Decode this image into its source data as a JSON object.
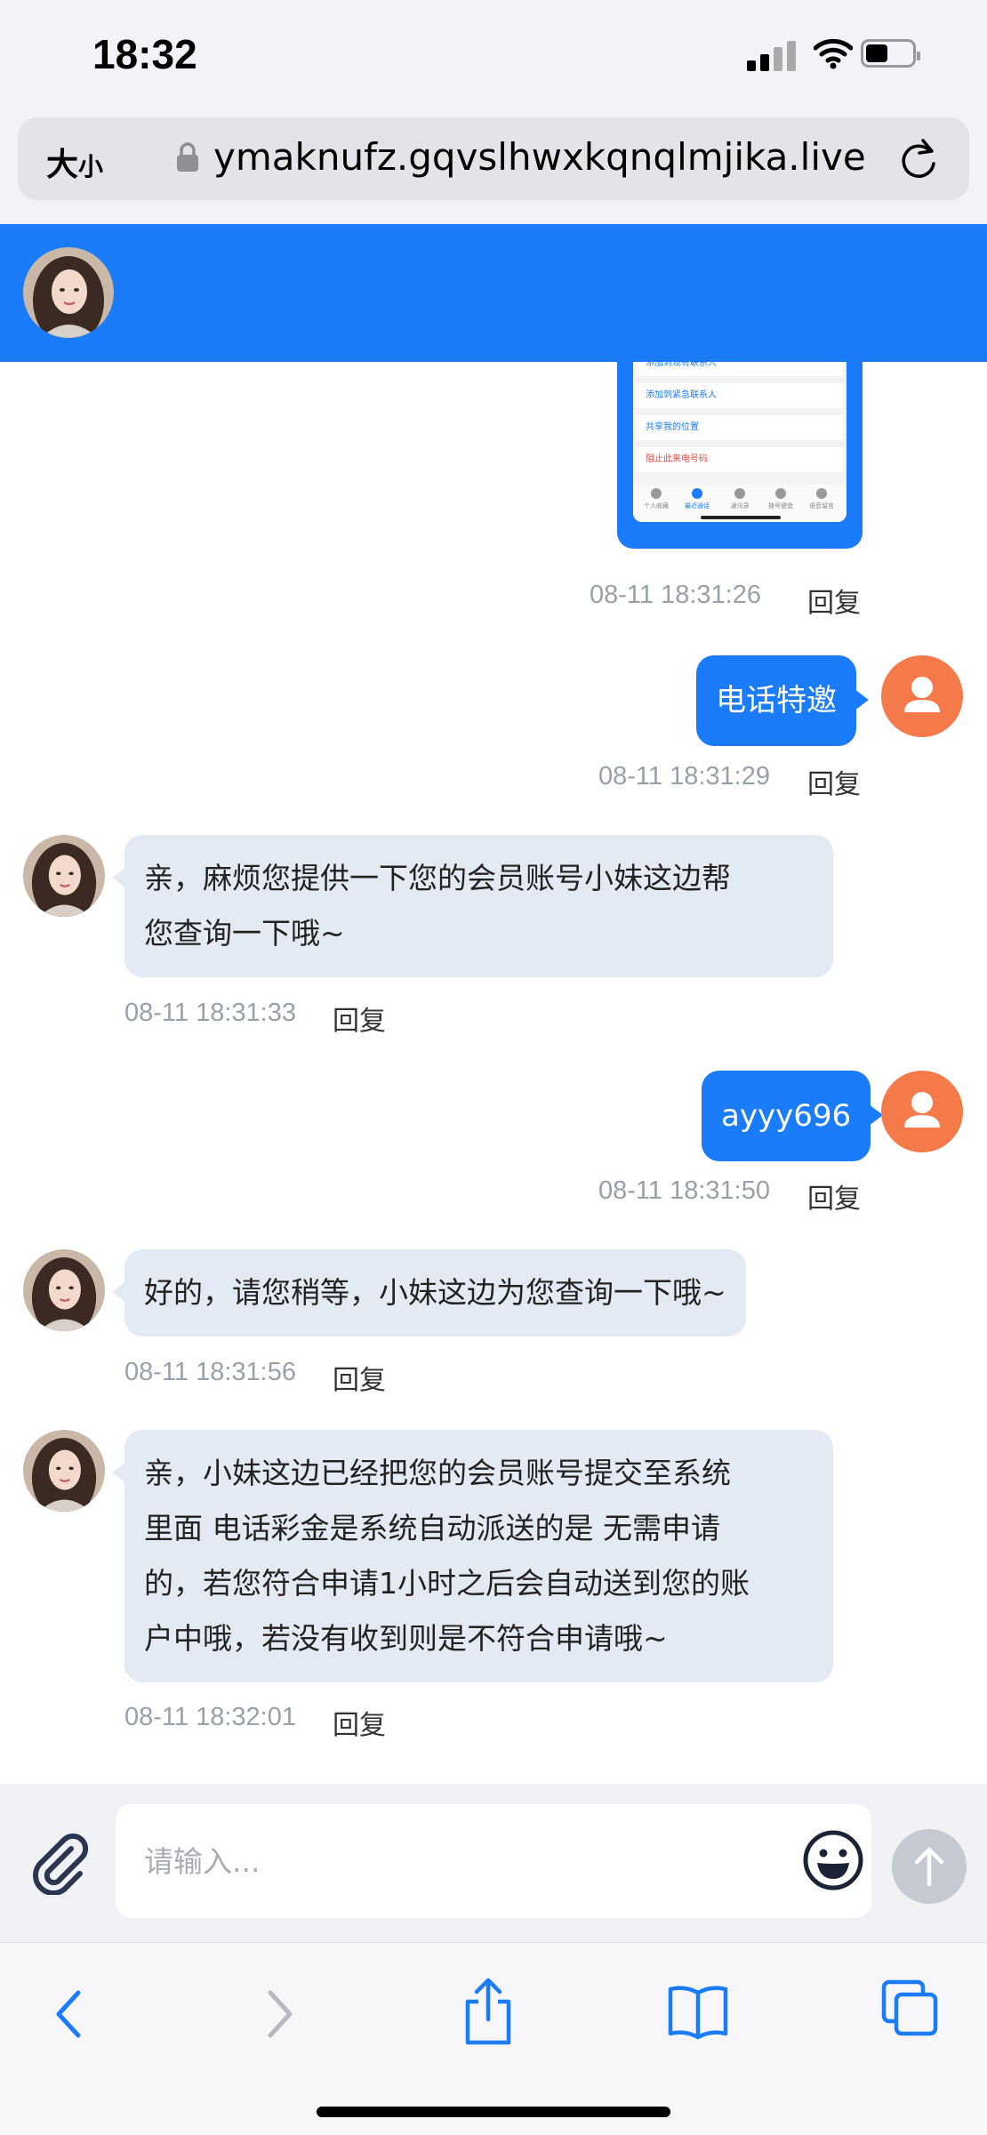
{
  "status_bar": {
    "time": "18:32"
  },
  "browser": {
    "text_size_label": "大",
    "text_size_small": "小",
    "url": "ymaknufz.gqvslhwxkqnqlmjika.live"
  },
  "thumbnail": {
    "rows": [
      "添加到现有联系人",
      "添加到紧急联系人",
      "共享我的位置",
      "阻止此来电号码"
    ],
    "tabs": [
      "个人收藏",
      "最近通话",
      "通讯录",
      "拨号键盘",
      "语音留言"
    ]
  },
  "reply_label": "回复",
  "messages": [
    {
      "side": "out",
      "text": "",
      "time": "08-11 18:31:26"
    },
    {
      "side": "out",
      "text": "电话特邀",
      "time": "08-11 18:31:29"
    },
    {
      "side": "in",
      "lines": [
        "亲，麻烦您提供一下您的会员账号小妹这边帮",
        "您查询一下哦~"
      ],
      "time": "08-11 18:31:33"
    },
    {
      "side": "out",
      "text": "ayyy696",
      "time": "08-11 18:31:50"
    },
    {
      "side": "in",
      "lines": [
        "好的，请您稍等，小妹这边为您查询一下哦~"
      ],
      "time": "08-11 18:31:56"
    },
    {
      "side": "in",
      "lines": [
        "亲，小妹这边已经把您的会员账号提交至系统",
        "里面 电话彩金是系统自动派送的是 无需申请",
        "的，若您符合申请1小时之后会自动送到您的账",
        "户中哦，若没有收到则是不符合申请哦~"
      ],
      "time": "08-11 18:32:01"
    }
  ],
  "composer": {
    "placeholder": "请输入..."
  },
  "colors": {
    "accent": "#1a7cf8",
    "user_avatar": "#f47a4a",
    "incoming_bubble": "#e4eaf3"
  }
}
